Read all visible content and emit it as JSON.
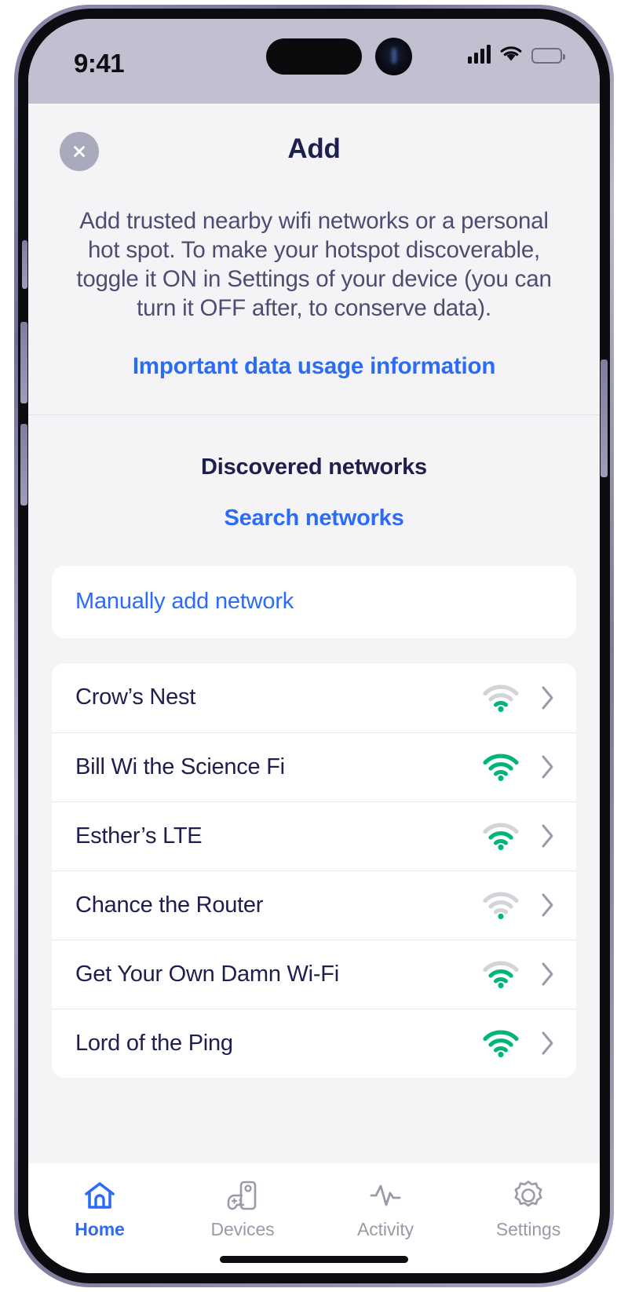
{
  "status_bar": {
    "time": "9:41",
    "signal_icon": "cellular-signal-icon",
    "wifi_icon": "wifi-icon",
    "battery_icon": "battery-full-icon"
  },
  "header": {
    "title": "Add",
    "close_icon": "close-icon"
  },
  "intro": {
    "text": "Add trusted nearby wifi networks or a personal hot spot. To make your hotspot discoverable, toggle it ON in Settings of your device (you can turn it OFF after, to conserve data).",
    "link_label": "Important data usage information"
  },
  "discovered": {
    "title": "Discovered networks",
    "search_link_label": "Search networks",
    "manual_add_label": "Manually add network"
  },
  "networks": [
    {
      "name": "Crow’s Nest",
      "signal": 1,
      "wifi_icon": "wifi-signal-weak-icon",
      "chevron_icon": "chevron-right-icon"
    },
    {
      "name": "Bill Wi the Science Fi",
      "signal": 3,
      "wifi_icon": "wifi-signal-full-icon",
      "chevron_icon": "chevron-right-icon"
    },
    {
      "name": "Esther’s LTE",
      "signal": 2,
      "wifi_icon": "wifi-signal-medium-icon",
      "chevron_icon": "chevron-right-icon"
    },
    {
      "name": "Chance the Router",
      "signal": 0,
      "wifi_icon": "wifi-signal-none-icon",
      "chevron_icon": "chevron-right-icon"
    },
    {
      "name": "Get Your Own Damn Wi-Fi",
      "signal": 2,
      "wifi_icon": "wifi-signal-medium-icon",
      "chevron_icon": "chevron-right-icon"
    },
    {
      "name": "Lord of the Ping",
      "signal": 3,
      "wifi_icon": "wifi-signal-full-icon",
      "chevron_icon": "chevron-right-icon"
    }
  ],
  "tabs": [
    {
      "label": "Home",
      "icon": "home-icon",
      "active": true
    },
    {
      "label": "Devices",
      "icon": "devices-icon",
      "active": false
    },
    {
      "label": "Activity",
      "icon": "activity-icon",
      "active": false
    },
    {
      "label": "Settings",
      "icon": "gear-icon",
      "active": false
    }
  ],
  "colors": {
    "accent_blue": "#2c6bf5",
    "navy_text": "#1d1f4e",
    "body_text": "#4b4d72",
    "signal_green": "#00b674",
    "signal_gray": "#d3d3da",
    "chevron_gray": "#9a9aa8",
    "page_bg": "#f4f4f6",
    "card_bg": "#ffffff",
    "status_bar_bg": "#c1c0d0"
  }
}
